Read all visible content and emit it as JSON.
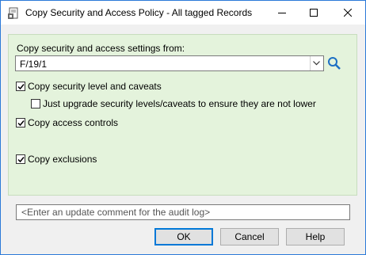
{
  "window": {
    "title": "Copy Security and Access Policy - All tagged Records"
  },
  "form": {
    "copy_from_label": "Copy security and access settings from:",
    "copy_from_value": "F/19/1",
    "options": [
      {
        "label": "Copy security level and caveats",
        "checked": true
      },
      {
        "label": "Just upgrade security levels/caveats to ensure they are not lower",
        "checked": false
      },
      {
        "label": "Copy access controls",
        "checked": true
      },
      {
        "label": "Copy exclusions",
        "checked": true
      }
    ]
  },
  "comment": {
    "placeholder": "<Enter an update comment for the audit log>"
  },
  "buttons": {
    "ok": "OK",
    "cancel": "Cancel",
    "help": "Help"
  },
  "colors": {
    "panel_background": "#e4f3dc",
    "default_button_border": "#0078d7"
  }
}
